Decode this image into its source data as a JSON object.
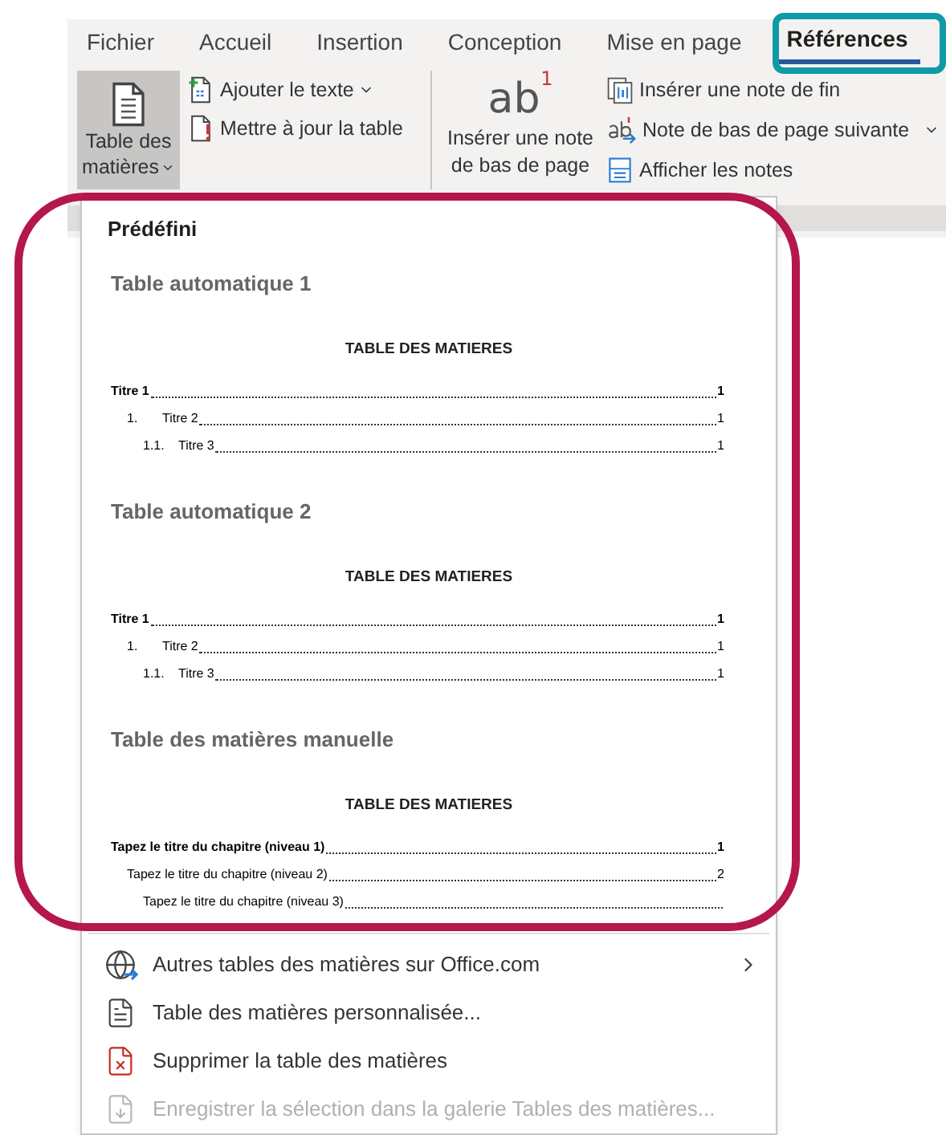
{
  "tabs": [
    {
      "label": "Fichier",
      "selected": false
    },
    {
      "label": "Accueil",
      "selected": false
    },
    {
      "label": "Insertion",
      "selected": false
    },
    {
      "label": "Conception",
      "selected": false
    },
    {
      "label": "Mise en page",
      "selected": false
    },
    {
      "label": "Références",
      "selected": true
    }
  ],
  "ribbon": {
    "toc_button": {
      "label_lines": [
        "Table des",
        "matières"
      ],
      "selected": true
    },
    "toc_commands": [
      {
        "kind": "add",
        "label": "Ajouter le texte",
        "dropdown": true
      },
      {
        "kind": "update",
        "label": "Mettre à jour la table",
        "dropdown": false
      }
    ],
    "footnote_button": {
      "icon_text": "ab",
      "icon_mark": "1",
      "label_lines": [
        "Insérer une note",
        "de bas de page"
      ]
    },
    "note_commands": [
      {
        "kind": "endnote",
        "label": "Insérer une note de fin",
        "dropdown": false
      },
      {
        "kind": "next",
        "label": "Note de bas de page suivante",
        "dropdown": true
      },
      {
        "kind": "show",
        "label": "Afficher les notes",
        "dropdown": false
      }
    ]
  },
  "menu": {
    "section_header": "Prédéfini",
    "gallery": [
      {
        "title": "Table automatique 1",
        "preview": {
          "heading": "TABLE DES MATIERES",
          "entries": [
            {
              "text": "Titre 1",
              "page": "1",
              "children": [
                {
                  "number": "1.",
                  "text": "Titre 2",
                  "page": "1",
                  "children": [
                    {
                      "number": "1.1.",
                      "text": "Titre 3",
                      "page": "1"
                    }
                  ]
                }
              ]
            }
          ]
        }
      },
      {
        "title": "Table automatique 2",
        "preview": {
          "heading": "TABLE DES MATIERES",
          "entries": [
            {
              "text": "Titre 1",
              "page": "1",
              "children": [
                {
                  "number": "1.",
                  "text": "Titre 2",
                  "page": "1",
                  "children": [
                    {
                      "number": "1.1.",
                      "text": "Titre 3",
                      "page": "1"
                    }
                  ]
                }
              ]
            }
          ]
        }
      },
      {
        "title": "Table des matières manuelle",
        "preview": {
          "heading": "TABLE DES MATIERES",
          "entries": [
            {
              "text": "Tapez le titre du chapitre (niveau 1)",
              "page": "1",
              "children": [
                {
                  "text": "Tapez le titre du chapitre (niveau 2)",
                  "page": "2",
                  "children": [
                    {
                      "text": "Tapez le titre du chapitre (niveau 3)"
                    }
                  ]
                }
              ]
            }
          ]
        }
      }
    ],
    "commands": [
      {
        "kind": "online",
        "label": "Autres tables des matières sur Office.com",
        "submenu": true,
        "disabled": false
      },
      {
        "kind": "custom",
        "label": "Table des matières personnalisée...",
        "submenu": false,
        "disabled": false
      },
      {
        "kind": "remove",
        "label": "Supprimer la table des matières",
        "submenu": false,
        "disabled": false
      },
      {
        "kind": "save",
        "label": "Enregistrer la sélection dans la galerie Tables des matières...",
        "submenu": false,
        "disabled": true
      }
    ]
  }
}
